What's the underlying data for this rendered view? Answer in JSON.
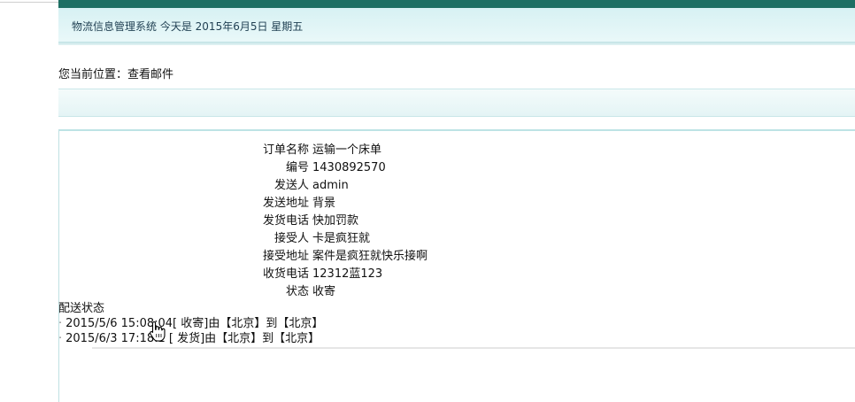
{
  "header": {
    "system_title": "物流信息管理系统",
    "date_text": "今天是 2015年6月5日 星期五"
  },
  "breadcrumb": {
    "label": "您当前位置：",
    "current": "查看邮件"
  },
  "details": [
    {
      "label": "订单名称",
      "value": "运输一个床单"
    },
    {
      "label": "编号",
      "value": "1430892570"
    },
    {
      "label": "发送人",
      "value": "admin"
    },
    {
      "label": "发送地址",
      "value": "背景"
    },
    {
      "label": "发货电话",
      "value": "快加罚款"
    },
    {
      "label": "接受人",
      "value": "卡是疯狂就"
    },
    {
      "label": "接受地址",
      "value": "案件是疯狂就快乐接啊"
    },
    {
      "label": "收货电话",
      "value": "12312蓝123"
    },
    {
      "label": "状态",
      "value": "收寄"
    }
  ],
  "delivery": {
    "title": "配送状态",
    "bullet": "·",
    "items": [
      {
        "text": "2015/5/6 15:08:04[ 收寄]由【北京】到【北京】"
      },
      {
        "text": "2015/6/3 17:18:1 [ 发货]由【北京】到【北京】"
      }
    ]
  },
  "cursor": {
    "icon": "hand-pointer-icon"
  }
}
